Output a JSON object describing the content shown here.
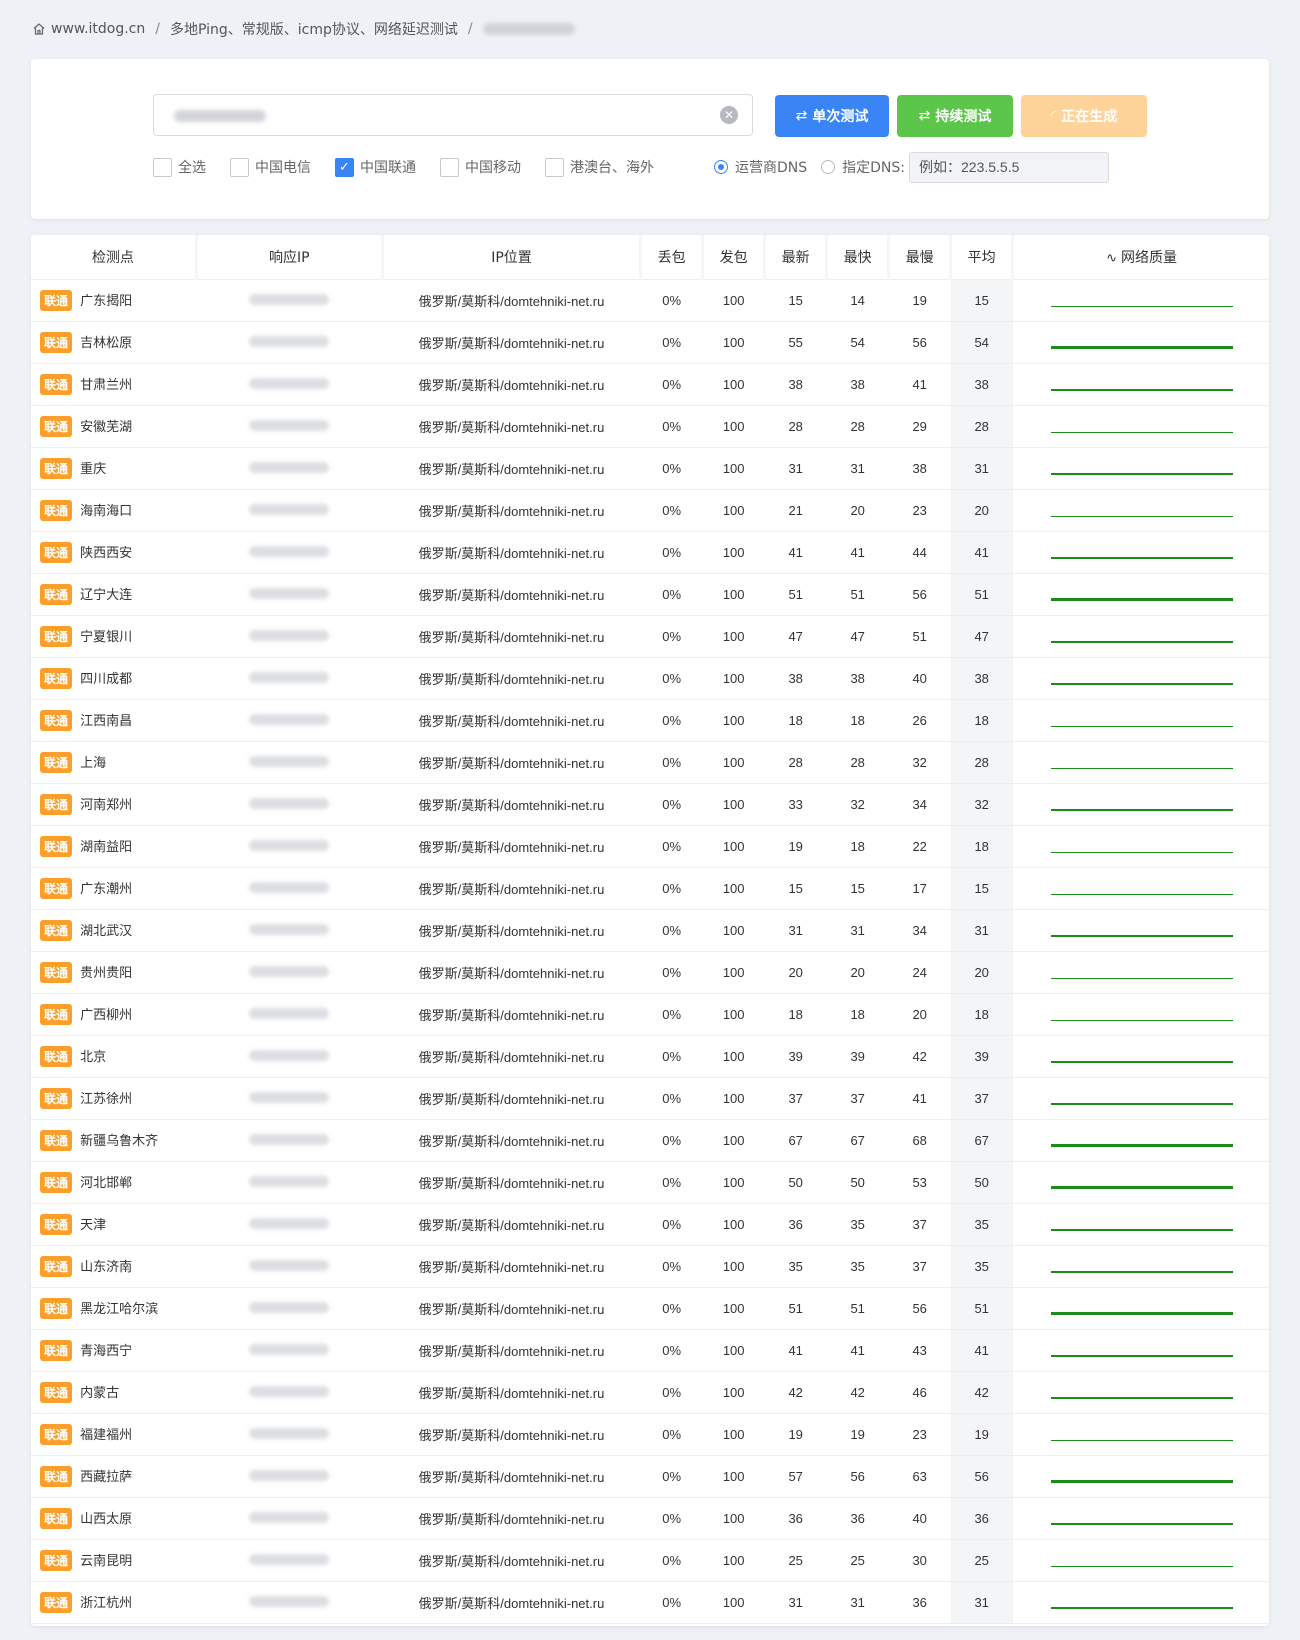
{
  "breadcrumb": {
    "site": "www.itdog.cn",
    "section": "多地Ping、常规版、icmp协议、网络延迟测试"
  },
  "search": {
    "target_value": ""
  },
  "buttons": {
    "single": "单次测试",
    "continuous": "持续测试",
    "generating": "正在生成"
  },
  "filters": {
    "all": "全选",
    "telecom": "中国电信",
    "unicom": "中国联通",
    "mobile": "中国移动",
    "overseas": "港澳台、海外",
    "isp_dns": "运营商DNS",
    "custom_dns": "指定DNS:",
    "dns_placeholder": "例如：223.5.5.5"
  },
  "table": {
    "headers": [
      "检测点",
      "响应IP",
      "IP位置",
      "丢包",
      "发包",
      "最新",
      "最快",
      "最慢",
      "平均",
      "网络质量"
    ],
    "rows": [
      {
        "isp": "联通",
        "node": "广东揭阳",
        "loc": "俄罗斯/莫斯科/domtehniki-net.ru",
        "loss": "0%",
        "sent": "100",
        "latest": "15",
        "fastest": "14",
        "slowest": "19",
        "avg": "15"
      },
      {
        "isp": "联通",
        "node": "吉林松原",
        "loc": "俄罗斯/莫斯科/domtehniki-net.ru",
        "loss": "0%",
        "sent": "100",
        "latest": "55",
        "fastest": "54",
        "slowest": "56",
        "avg": "54"
      },
      {
        "isp": "联通",
        "node": "甘肃兰州",
        "loc": "俄罗斯/莫斯科/domtehniki-net.ru",
        "loss": "0%",
        "sent": "100",
        "latest": "38",
        "fastest": "38",
        "slowest": "41",
        "avg": "38"
      },
      {
        "isp": "联通",
        "node": "安徽芜湖",
        "loc": "俄罗斯/莫斯科/domtehniki-net.ru",
        "loss": "0%",
        "sent": "100",
        "latest": "28",
        "fastest": "28",
        "slowest": "29",
        "avg": "28"
      },
      {
        "isp": "联通",
        "node": "重庆",
        "loc": "俄罗斯/莫斯科/domtehniki-net.ru",
        "loss": "0%",
        "sent": "100",
        "latest": "31",
        "fastest": "31",
        "slowest": "38",
        "avg": "31"
      },
      {
        "isp": "联通",
        "node": "海南海口",
        "loc": "俄罗斯/莫斯科/domtehniki-net.ru",
        "loss": "0%",
        "sent": "100",
        "latest": "21",
        "fastest": "20",
        "slowest": "23",
        "avg": "20"
      },
      {
        "isp": "联通",
        "node": "陕西西安",
        "loc": "俄罗斯/莫斯科/domtehniki-net.ru",
        "loss": "0%",
        "sent": "100",
        "latest": "41",
        "fastest": "41",
        "slowest": "44",
        "avg": "41"
      },
      {
        "isp": "联通",
        "node": "辽宁大连",
        "loc": "俄罗斯/莫斯科/domtehniki-net.ru",
        "loss": "0%",
        "sent": "100",
        "latest": "51",
        "fastest": "51",
        "slowest": "56",
        "avg": "51"
      },
      {
        "isp": "联通",
        "node": "宁夏银川",
        "loc": "俄罗斯/莫斯科/domtehniki-net.ru",
        "loss": "0%",
        "sent": "100",
        "latest": "47",
        "fastest": "47",
        "slowest": "51",
        "avg": "47"
      },
      {
        "isp": "联通",
        "node": "四川成都",
        "loc": "俄罗斯/莫斯科/domtehniki-net.ru",
        "loss": "0%",
        "sent": "100",
        "latest": "38",
        "fastest": "38",
        "slowest": "40",
        "avg": "38"
      },
      {
        "isp": "联通",
        "node": "江西南昌",
        "loc": "俄罗斯/莫斯科/domtehniki-net.ru",
        "loss": "0%",
        "sent": "100",
        "latest": "18",
        "fastest": "18",
        "slowest": "26",
        "avg": "18"
      },
      {
        "isp": "联通",
        "node": "上海",
        "loc": "俄罗斯/莫斯科/domtehniki-net.ru",
        "loss": "0%",
        "sent": "100",
        "latest": "28",
        "fastest": "28",
        "slowest": "32",
        "avg": "28"
      },
      {
        "isp": "联通",
        "node": "河南郑州",
        "loc": "俄罗斯/莫斯科/domtehniki-net.ru",
        "loss": "0%",
        "sent": "100",
        "latest": "33",
        "fastest": "32",
        "slowest": "34",
        "avg": "32"
      },
      {
        "isp": "联通",
        "node": "湖南益阳",
        "loc": "俄罗斯/莫斯科/domtehniki-net.ru",
        "loss": "0%",
        "sent": "100",
        "latest": "19",
        "fastest": "18",
        "slowest": "22",
        "avg": "18"
      },
      {
        "isp": "联通",
        "node": "广东潮州",
        "loc": "俄罗斯/莫斯科/domtehniki-net.ru",
        "loss": "0%",
        "sent": "100",
        "latest": "15",
        "fastest": "15",
        "slowest": "17",
        "avg": "15"
      },
      {
        "isp": "联通",
        "node": "湖北武汉",
        "loc": "俄罗斯/莫斯科/domtehniki-net.ru",
        "loss": "0%",
        "sent": "100",
        "latest": "31",
        "fastest": "31",
        "slowest": "34",
        "avg": "31"
      },
      {
        "isp": "联通",
        "node": "贵州贵阳",
        "loc": "俄罗斯/莫斯科/domtehniki-net.ru",
        "loss": "0%",
        "sent": "100",
        "latest": "20",
        "fastest": "20",
        "slowest": "24",
        "avg": "20"
      },
      {
        "isp": "联通",
        "node": "广西柳州",
        "loc": "俄罗斯/莫斯科/domtehniki-net.ru",
        "loss": "0%",
        "sent": "100",
        "latest": "18",
        "fastest": "18",
        "slowest": "20",
        "avg": "18"
      },
      {
        "isp": "联通",
        "node": "北京",
        "loc": "俄罗斯/莫斯科/domtehniki-net.ru",
        "loss": "0%",
        "sent": "100",
        "latest": "39",
        "fastest": "39",
        "slowest": "42",
        "avg": "39"
      },
      {
        "isp": "联通",
        "node": "江苏徐州",
        "loc": "俄罗斯/莫斯科/domtehniki-net.ru",
        "loss": "0%",
        "sent": "100",
        "latest": "37",
        "fastest": "37",
        "slowest": "41",
        "avg": "37"
      },
      {
        "isp": "联通",
        "node": "新疆乌鲁木齐",
        "loc": "俄罗斯/莫斯科/domtehniki-net.ru",
        "loss": "0%",
        "sent": "100",
        "latest": "67",
        "fastest": "67",
        "slowest": "68",
        "avg": "67"
      },
      {
        "isp": "联通",
        "node": "河北邯郸",
        "loc": "俄罗斯/莫斯科/domtehniki-net.ru",
        "loss": "0%",
        "sent": "100",
        "latest": "50",
        "fastest": "50",
        "slowest": "53",
        "avg": "50"
      },
      {
        "isp": "联通",
        "node": "天津",
        "loc": "俄罗斯/莫斯科/domtehniki-net.ru",
        "loss": "0%",
        "sent": "100",
        "latest": "36",
        "fastest": "35",
        "slowest": "37",
        "avg": "35"
      },
      {
        "isp": "联通",
        "node": "山东济南",
        "loc": "俄罗斯/莫斯科/domtehniki-net.ru",
        "loss": "0%",
        "sent": "100",
        "latest": "35",
        "fastest": "35",
        "slowest": "37",
        "avg": "35"
      },
      {
        "isp": "联通",
        "node": "黑龙江哈尔滨",
        "loc": "俄罗斯/莫斯科/domtehniki-net.ru",
        "loss": "0%",
        "sent": "100",
        "latest": "51",
        "fastest": "51",
        "slowest": "56",
        "avg": "51"
      },
      {
        "isp": "联通",
        "node": "青海西宁",
        "loc": "俄罗斯/莫斯科/domtehniki-net.ru",
        "loss": "0%",
        "sent": "100",
        "latest": "41",
        "fastest": "41",
        "slowest": "43",
        "avg": "41"
      },
      {
        "isp": "联通",
        "node": "内蒙古",
        "loc": "俄罗斯/莫斯科/domtehniki-net.ru",
        "loss": "0%",
        "sent": "100",
        "latest": "42",
        "fastest": "42",
        "slowest": "46",
        "avg": "42"
      },
      {
        "isp": "联通",
        "node": "福建福州",
        "loc": "俄罗斯/莫斯科/domtehniki-net.ru",
        "loss": "0%",
        "sent": "100",
        "latest": "19",
        "fastest": "19",
        "slowest": "23",
        "avg": "19"
      },
      {
        "isp": "联通",
        "node": "西藏拉萨",
        "loc": "俄罗斯/莫斯科/domtehniki-net.ru",
        "loss": "0%",
        "sent": "100",
        "latest": "57",
        "fastest": "56",
        "slowest": "63",
        "avg": "56"
      },
      {
        "isp": "联通",
        "node": "山西太原",
        "loc": "俄罗斯/莫斯科/domtehniki-net.ru",
        "loss": "0%",
        "sent": "100",
        "latest": "36",
        "fastest": "36",
        "slowest": "40",
        "avg": "36"
      },
      {
        "isp": "联通",
        "node": "云南昆明",
        "loc": "俄罗斯/莫斯科/domtehniki-net.ru",
        "loss": "0%",
        "sent": "100",
        "latest": "25",
        "fastest": "25",
        "slowest": "30",
        "avg": "25"
      },
      {
        "isp": "联通",
        "node": "浙江杭州",
        "loc": "俄罗斯/莫斯科/domtehniki-net.ru",
        "loss": "0%",
        "sent": "100",
        "latest": "31",
        "fastest": "31",
        "slowest": "36",
        "avg": "31"
      }
    ]
  },
  "colors": {
    "primary": "#3a85f6",
    "success": "#5cc64a",
    "warning_light": "#fdd39a",
    "badge": "#fb9e2a",
    "quality_line": "#198c19"
  }
}
